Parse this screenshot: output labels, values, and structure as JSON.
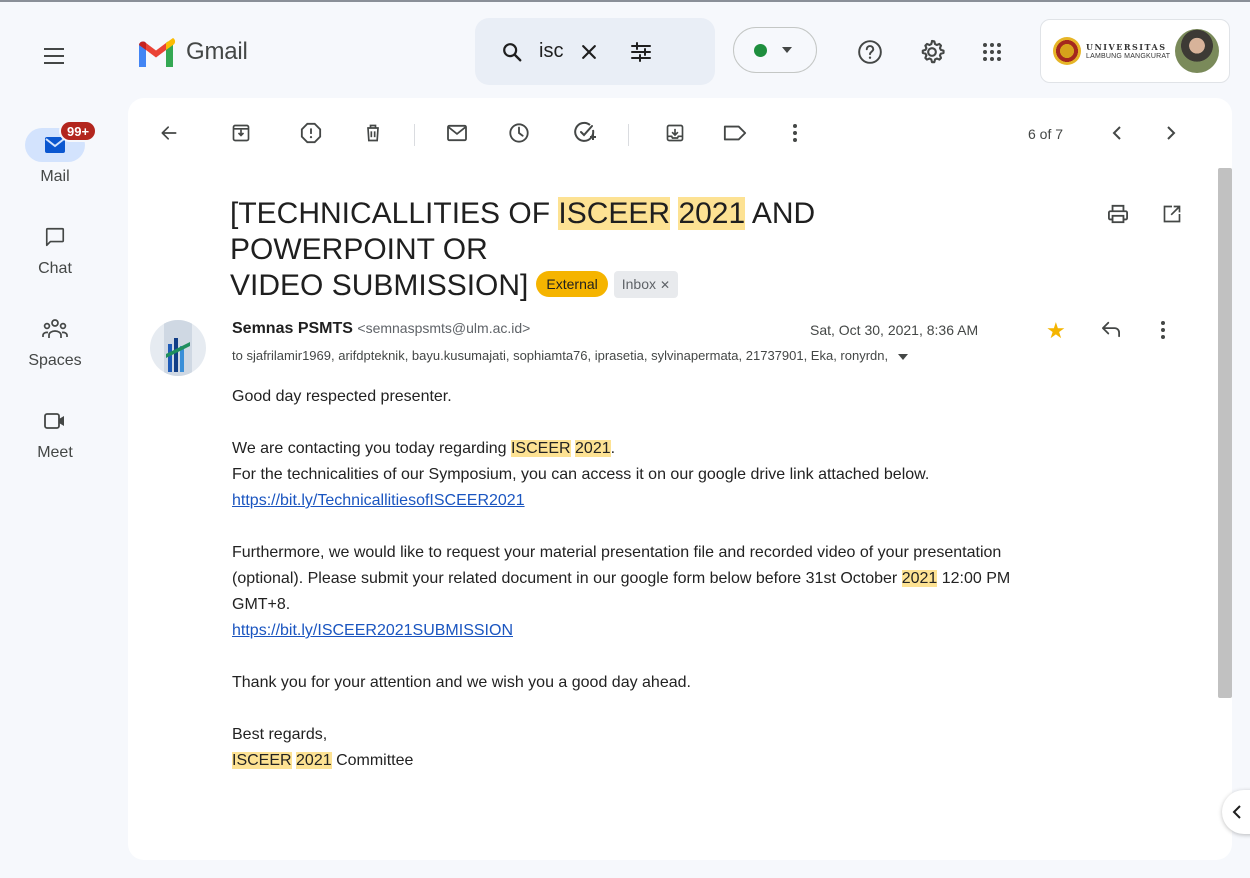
{
  "app": {
    "name": "Gmail"
  },
  "search": {
    "value": "isc"
  },
  "account": {
    "org_line1": "UNIVERSITAS",
    "org_line2": "LAMBUNG MANGKURAT"
  },
  "rail": {
    "items": [
      {
        "label": "Mail",
        "badge": "99+"
      },
      {
        "label": "Chat"
      },
      {
        "label": "Spaces"
      },
      {
        "label": "Meet"
      }
    ]
  },
  "toolbar": {
    "paging": "6 of 7"
  },
  "email": {
    "subject_pre": "[TECHNICALLITIES OF ",
    "subject_hl1": "ISCEER",
    "subject_sp": " ",
    "subject_hl2": "2021",
    "subject_post1": " AND POWERPOINT OR",
    "subject_post2": "VIDEO SUBMISSION]",
    "labels": {
      "external": "External",
      "inbox": "Inbox"
    },
    "sender": {
      "name": "Semnas PSMTS",
      "address": "<semnaspsmts@ulm.ac.id>"
    },
    "recipients": "to sjafrilamir1969, arifdpteknik, bayu.kusumajati, sophiamta76, iprasetia, sylvinapermata, 21737901, Eka, ronyrdn,",
    "date": "Sat, Oct 30, 2021, 8:36 AM",
    "body": {
      "greeting": "Good day respected presenter.",
      "p2_pre": "We are contacting you today regarding ",
      "p2_hl1": "ISCEER",
      "p2_hl2": "2021",
      "p2_end": ".",
      "p3": "For the technicalities of our Symposium, you can access it on our google drive link attached below.",
      "link1": "https://bit.ly/TechnicallitiesofISCEER2021",
      "p4a": "Furthermore, we would like to request your material presentation file and recorded video of your presentation",
      "p4b_pre": "(optional). Please submit your related document in our google form below before 31st October ",
      "p4b_hl": "2021",
      "p4b_post": " 12:00 PM",
      "p4c": "GMT+8.",
      "link2": "https://bit.ly/ISCEER2021SUBMISSION",
      "p5": "Thank you for your attention and we wish you a good day ahead.",
      "p6": "Best regards,",
      "sig_hl1": "ISCEER",
      "sig_hl2": "2021",
      "sig_post": " Committee"
    }
  },
  "colors": {
    "highlight": "#fde293",
    "external_label": "#f5b400",
    "badge": "#b3261e",
    "star": "#f4b400",
    "link": "#1a55c0"
  },
  "icons": {
    "menu": "menu-icon",
    "search": "search-icon",
    "clear": "close-icon",
    "filter": "tune-icon",
    "help": "help-icon",
    "settings": "gear-icon",
    "apps": "apps-grid-icon",
    "back": "arrow-left-icon",
    "archive": "archive-icon",
    "spam": "report-icon",
    "delete": "trash-icon",
    "unread": "mail-icon",
    "snooze": "clock-icon",
    "task": "add-task-icon",
    "move": "move-to-icon",
    "label": "label-icon",
    "more": "more-vert-icon",
    "prev": "chevron-left-icon",
    "next": "chevron-right-icon",
    "print": "print-icon",
    "open-new": "open-in-new-icon",
    "star": "star-icon",
    "reply": "reply-icon"
  }
}
